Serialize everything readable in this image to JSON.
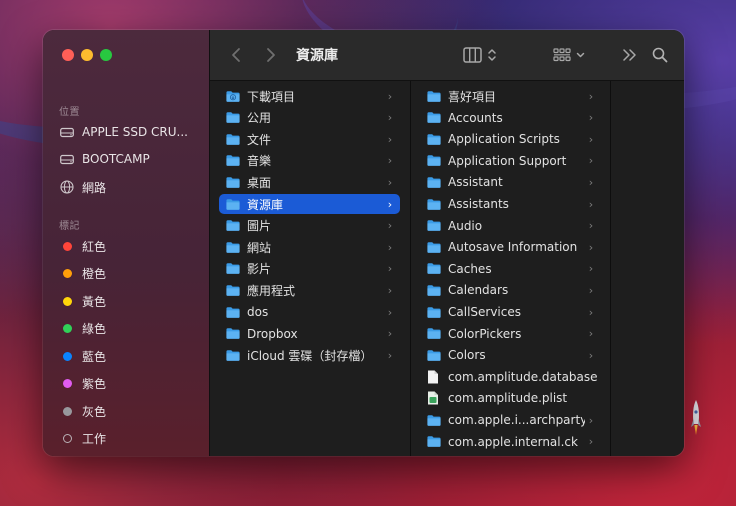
{
  "window": {
    "title": "資源庫"
  },
  "sidebar": {
    "locations_title": "位置",
    "locations": [
      {
        "label": "APPLE SSD CRU...",
        "icon": "drive-icon"
      },
      {
        "label": "BOOTCAMP",
        "icon": "drive-icon"
      },
      {
        "label": "網路",
        "icon": "globe-icon"
      }
    ],
    "tags_title": "標記",
    "tags": [
      {
        "label": "紅色",
        "color": "#ff453a"
      },
      {
        "label": "橙色",
        "color": "#ff9f0a"
      },
      {
        "label": "黃色",
        "color": "#ffd60a"
      },
      {
        "label": "綠色",
        "color": "#30d158"
      },
      {
        "label": "藍色",
        "color": "#0a84ff"
      },
      {
        "label": "紫色",
        "color": "#e05cf0"
      },
      {
        "label": "灰色",
        "color": "#98989d"
      },
      {
        "label": "工作",
        "color": "none"
      }
    ]
  },
  "toolbar": {
    "back_icon": "chevron-left-icon",
    "forward_icon": "chevron-right-icon",
    "view_icon": "columns-view-icon",
    "group_icon": "grid-group-icon",
    "more_icon": "double-chevron-icon",
    "search_icon": "search-icon"
  },
  "columns": {
    "first": [
      {
        "label": "下載項目",
        "type": "folder-download"
      },
      {
        "label": "公用",
        "type": "folder"
      },
      {
        "label": "文件",
        "type": "folder"
      },
      {
        "label": "音樂",
        "type": "folder"
      },
      {
        "label": "桌面",
        "type": "folder"
      },
      {
        "label": "資源庫",
        "type": "folder",
        "selected": true
      },
      {
        "label": "圖片",
        "type": "folder"
      },
      {
        "label": "網站",
        "type": "folder"
      },
      {
        "label": "影片",
        "type": "folder"
      },
      {
        "label": "應用程式",
        "type": "folder"
      },
      {
        "label": "dos",
        "type": "folder"
      },
      {
        "label": "Dropbox",
        "type": "folder"
      },
      {
        "label": "iCloud 雲碟（封存檔）",
        "type": "folder"
      }
    ],
    "second": [
      {
        "label": "喜好項目",
        "type": "folder"
      },
      {
        "label": "Accounts",
        "type": "folder"
      },
      {
        "label": "Application Scripts",
        "type": "folder"
      },
      {
        "label": "Application Support",
        "type": "folder"
      },
      {
        "label": "Assistant",
        "type": "folder"
      },
      {
        "label": "Assistants",
        "type": "folder"
      },
      {
        "label": "Audio",
        "type": "folder"
      },
      {
        "label": "Autosave Information",
        "type": "folder"
      },
      {
        "label": "Caches",
        "type": "folder"
      },
      {
        "label": "Calendars",
        "type": "folder"
      },
      {
        "label": "CallServices",
        "type": "folder"
      },
      {
        "label": "ColorPickers",
        "type": "folder"
      },
      {
        "label": "Colors",
        "type": "folder"
      },
      {
        "label": "com.amplitude.database",
        "type": "file"
      },
      {
        "label": "com.amplitude.plist",
        "type": "plist"
      },
      {
        "label": "com.apple.i...archpartyd",
        "type": "folder"
      },
      {
        "label": "com.apple.internal.ck",
        "type": "folder"
      }
    ]
  }
}
